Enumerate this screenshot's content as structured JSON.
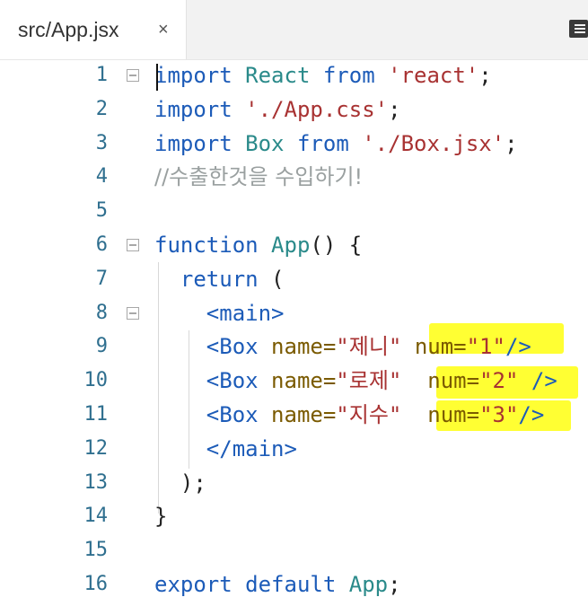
{
  "tab": {
    "title": "src/App.jsx",
    "close": "×"
  },
  "icons": {
    "close": "close-icon",
    "menu": "menu-icon",
    "fold": "fold-minus-icon"
  },
  "colors": {
    "highlight": "#ffff33",
    "keyword": "#1c5bb8",
    "string": "#a83232",
    "type": "#2a8a8a",
    "comment": "#9aa0a0",
    "line_number": "#2f6f8f"
  },
  "lines": [
    {
      "n": "1",
      "tokens": [
        [
          "kw",
          "import"
        ],
        [
          "pun",
          " "
        ],
        [
          "ty",
          "React"
        ],
        [
          "pun",
          " "
        ],
        [
          "kw",
          "from"
        ],
        [
          "pun",
          " "
        ],
        [
          "str",
          "'react'"
        ],
        [
          "pun",
          ";"
        ]
      ]
    },
    {
      "n": "2",
      "tokens": [
        [
          "kw",
          "import"
        ],
        [
          "pun",
          " "
        ],
        [
          "str",
          "'./App.css'"
        ],
        [
          "pun",
          ";"
        ]
      ]
    },
    {
      "n": "3",
      "tokens": [
        [
          "kw",
          "import"
        ],
        [
          "pun",
          " "
        ],
        [
          "ty",
          "Box"
        ],
        [
          "pun",
          " "
        ],
        [
          "kw",
          "from"
        ],
        [
          "pun",
          " "
        ],
        [
          "str",
          "'./Box.jsx'"
        ],
        [
          "pun",
          ";"
        ]
      ]
    },
    {
      "n": "4",
      "tokens": [
        [
          "cm",
          "//수출한것을 수입하기!"
        ]
      ]
    },
    {
      "n": "5",
      "tokens": []
    },
    {
      "n": "6",
      "tokens": [
        [
          "kw",
          "function"
        ],
        [
          "pun",
          " "
        ],
        [
          "ty",
          "App"
        ],
        [
          "pun",
          "() {"
        ]
      ]
    },
    {
      "n": "7",
      "tokens": [
        [
          "pun",
          "  "
        ],
        [
          "kw",
          "return"
        ],
        [
          "pun",
          " ("
        ]
      ]
    },
    {
      "n": "8",
      "tokens": [
        [
          "pun",
          "    "
        ],
        [
          "tag",
          "<main>"
        ]
      ]
    },
    {
      "n": "9",
      "tokens": [
        [
          "pun",
          "    "
        ],
        [
          "tag",
          "<Box"
        ],
        [
          "pun",
          " "
        ],
        [
          "attr",
          "name="
        ],
        [
          "str",
          "\"제니\""
        ],
        [
          "pun",
          " "
        ],
        [
          "attr",
          "num="
        ],
        [
          "str",
          "\"1\""
        ],
        [
          "tag",
          "/>"
        ]
      ]
    },
    {
      "n": "10",
      "tokens": [
        [
          "pun",
          "    "
        ],
        [
          "tag",
          "<Box"
        ],
        [
          "pun",
          " "
        ],
        [
          "attr",
          "name="
        ],
        [
          "str",
          "\"로제\""
        ],
        [
          "pun",
          "  "
        ],
        [
          "attr",
          "num="
        ],
        [
          "str",
          "\"2\""
        ],
        [
          "pun",
          " "
        ],
        [
          "tag",
          "/>"
        ]
      ]
    },
    {
      "n": "11",
      "tokens": [
        [
          "pun",
          "    "
        ],
        [
          "tag",
          "<Box"
        ],
        [
          "pun",
          " "
        ],
        [
          "attr",
          "name="
        ],
        [
          "str",
          "\"지수\""
        ],
        [
          "pun",
          "  "
        ],
        [
          "attr",
          "num="
        ],
        [
          "str",
          "\"3\""
        ],
        [
          "tag",
          "/>"
        ]
      ]
    },
    {
      "n": "12",
      "tokens": [
        [
          "pun",
          "    "
        ],
        [
          "tag",
          "</main>"
        ]
      ]
    },
    {
      "n": "13",
      "tokens": [
        [
          "pun",
          "  );"
        ]
      ]
    },
    {
      "n": "14",
      "tokens": [
        [
          "pun",
          "}"
        ]
      ]
    },
    {
      "n": "15",
      "tokens": []
    },
    {
      "n": "16",
      "tokens": [
        [
          "kw",
          "export"
        ],
        [
          "pun",
          " "
        ],
        [
          "kw",
          "default"
        ],
        [
          "pun",
          " "
        ],
        [
          "ty",
          "App"
        ],
        [
          "pun",
          ";"
        ]
      ]
    }
  ]
}
